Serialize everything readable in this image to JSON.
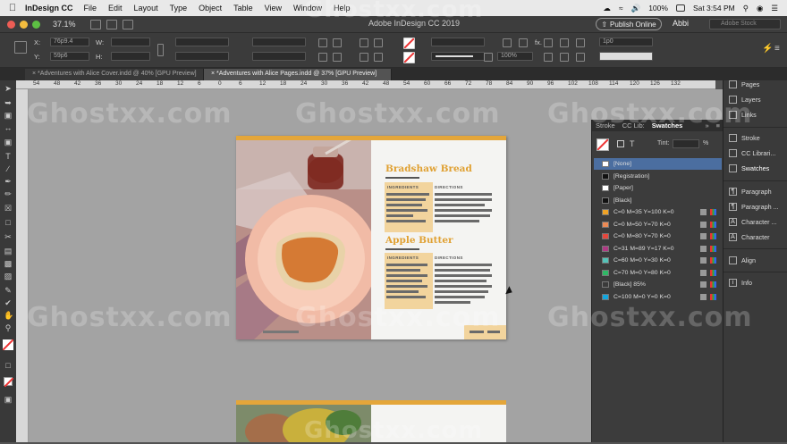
{
  "menubar": {
    "app_name": "InDesign CC",
    "items": [
      "File",
      "Edit",
      "Layout",
      "Type",
      "Object",
      "Table",
      "View",
      "Window",
      "Help"
    ],
    "battery": "100%",
    "clock": "Sat 3:54 PM"
  },
  "app_bar": {
    "zoom": "37.1%",
    "window_title": "Adobe InDesign CC 2019",
    "publish_label": "Publish Online",
    "user": "Abbi",
    "stock_placeholder": "Adobe Stock"
  },
  "control_panel": {
    "x_label": "X:",
    "x_value": "76p9.4",
    "y_label": "Y:",
    "y_value": "59p6",
    "w_label": "W:",
    "h_label": "H:",
    "stroke_weight": "1p0",
    "opacity": "100%"
  },
  "doc_tabs": [
    {
      "label": "*Adventures with Alice Cover.indd @ 40% [GPU Preview]",
      "active": false
    },
    {
      "label": "*Adventures with Alice Pages.indd @ 37% [GPU Preview]",
      "active": true
    }
  ],
  "ruler": {
    "ticks": [
      "54",
      "48",
      "42",
      "36",
      "30",
      "24",
      "18",
      "12",
      "6",
      "0",
      "6",
      "12",
      "18",
      "24",
      "30",
      "36",
      "42",
      "48",
      "54",
      "60",
      "66",
      "72",
      "78",
      "84",
      "90",
      "96",
      "102",
      "108",
      "114",
      "120",
      "126",
      "132"
    ]
  },
  "page": {
    "recipe1_title": "Bradshaw Bread",
    "recipe2_title": "Apple Butter",
    "ingredients_label": "INGREDIENTS",
    "directions_label": "DIRECTIONS"
  },
  "swatches_panel": {
    "tabs": [
      "Stroke",
      "CC Lib:",
      "Swatches"
    ],
    "tint_label": "Tint:",
    "tint_unit": "%",
    "items": [
      {
        "name": "[None]",
        "color": "#ffffff",
        "selected": true
      },
      {
        "name": "[Registration]",
        "color": "#111111",
        "selected": false
      },
      {
        "name": "[Paper]",
        "color": "#ffffff",
        "selected": false
      },
      {
        "name": "[Black]",
        "color": "#111111",
        "selected": false
      },
      {
        "name": "C=0 M=35 Y=100 K=0",
        "color": "#f0a326",
        "selected": false
      },
      {
        "name": "C=0 M=50 Y=70 K=0",
        "color": "#ec8a55",
        "selected": false
      },
      {
        "name": "C=0 M=80 Y=70 K=0",
        "color": "#e5473d",
        "selected": false
      },
      {
        "name": "C=31 M=89 Y=17 K=0",
        "color": "#b03a84",
        "selected": false
      },
      {
        "name": "C=60 M=0 Y=30 K=0",
        "color": "#55c2b8",
        "selected": false
      },
      {
        "name": "C=70 M=0 Y=80 K=0",
        "color": "#2fb865",
        "selected": false
      },
      {
        "name": "[Black] 85%",
        "color": "#3a3a3a",
        "selected": false
      },
      {
        "name": "C=100 M=0 Y=0 K=0",
        "color": "#13a7df",
        "selected": false
      }
    ]
  },
  "right_panel": {
    "items": [
      "Pages",
      "Layers",
      "Links",
      "Stroke",
      "CC Librari...",
      "Swatches",
      "Paragraph",
      "Paragraph ...",
      "Character ...",
      "Character",
      "Align",
      "Info"
    ]
  },
  "watermark": "Ghostxx.com",
  "colors": {
    "accent": "#e4a63a",
    "panel_bg": "#3c3c3c",
    "selection": "#4b6ea0"
  }
}
